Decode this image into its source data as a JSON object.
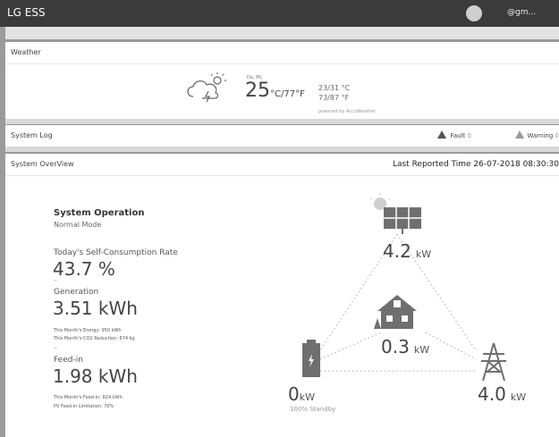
{
  "header": {
    "app_title": "LG ESS",
    "user": "@gm..."
  },
  "weather": {
    "section_title": "Weather",
    "location": "Da, ML",
    "temp_value": "25",
    "temp_unit": "°C/77°F",
    "high": "23/31 °C",
    "low": "73/87 °F",
    "powered_by": "powered by AccuWeather"
  },
  "system_log": {
    "section_title": "System Log",
    "fault_label": "Fault",
    "fault_count": "0",
    "warning_label": "Warning",
    "warning_count": "0"
  },
  "overview": {
    "section_title": "System OverView",
    "last_reported": "Last Reported Time 26-07-2018 08:30:30",
    "operation_title": "System Operation",
    "operation_mode": "Normal Mode",
    "self_consumption_label": "Today's Self-Consumption Rate",
    "self_consumption_value": "43.7 %",
    "dash": "–",
    "generation_label": "Generation",
    "generation_value": "3.51 kWh",
    "month_energy": "This Month's Energy: 950 kWh",
    "month_co2": "This Month's CO2 Reduction: 674 kg",
    "feedin_label": "Feed-in",
    "feedin_value": "1.98 kWh",
    "month_feedin": "This Month's Feed-in: 824 kWh",
    "pv_limit": "PV Feed-in Limitation: 70%",
    "diagram": {
      "pv_value": "4.2",
      "home_value": "0.3",
      "battery_value": "0",
      "grid_value": "4.0",
      "unit": "kW",
      "battery_status": "100% Standby"
    }
  },
  "colors": {
    "topbar": "#3b3b3b",
    "background": "#9a9a9a",
    "panel": "#ffffff",
    "icon": "#777777"
  }
}
